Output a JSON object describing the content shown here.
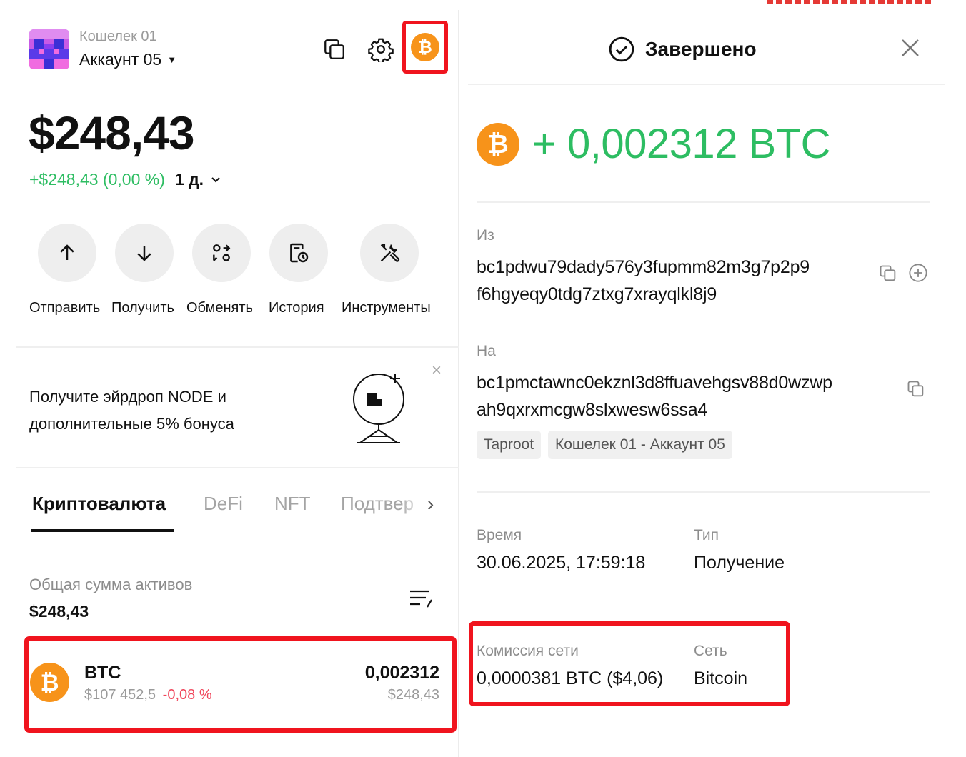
{
  "colors": {
    "accent_red": "#f0141e",
    "positive": "#2dbd62",
    "negative": "#f0455a",
    "btc_orange": "#f7931a"
  },
  "header": {
    "wallet_name": "Кошелек 01",
    "account_name": "Аккаунт 05",
    "icons": [
      "copy-icon",
      "gear-icon",
      "bitcoin-icon"
    ]
  },
  "balance": {
    "total": "$248,43",
    "change": "+$248,43 (0,00 %)",
    "period": "1 д."
  },
  "actions": [
    {
      "label": "Отправить",
      "icon": "arrow-up-icon"
    },
    {
      "label": "Получить",
      "icon": "arrow-down-icon"
    },
    {
      "label": "Обменять",
      "icon": "swap-icon"
    },
    {
      "label": "История",
      "icon": "history-icon"
    },
    {
      "label": "Инструменты",
      "icon": "tools-icon"
    }
  ],
  "promo": {
    "text": "Получите эйрдроп NODE и дополнительные 5% бонуса",
    "close": "×"
  },
  "tabs": [
    "Криптовалюта",
    "DeFi",
    "NFT",
    "Подтвер"
  ],
  "assets_summary": {
    "label": "Общая сумма активов",
    "value": "$248,43"
  },
  "assets": [
    {
      "name": "BTC",
      "price": "$107 452,5",
      "change": "-0,08 %",
      "amount": "0,002312",
      "fiat": "$248,43"
    }
  ],
  "detail": {
    "status": "Завершено",
    "amount": "+ 0,002312 BTC",
    "from_label": "Из",
    "from_line1": "bc1pdwu79dady576y3fupmm82m3g7p2p9",
    "from_line2": "f6hgyeqy0tdg7ztxg7xrayqlkl8j9",
    "to_label": "На",
    "to_line1": "bc1pmctawnc0ekznl3d8ffuavehgsv88d0wzwp",
    "to_line2": "ah9qxrxmcgw8slxwesw6ssa4",
    "to_tags": [
      "Taproot",
      "Кошелек 01 - Аккаунт 05"
    ],
    "time_label": "Время",
    "time_value": "30.06.2025, 17:59:18",
    "type_label": "Тип",
    "type_value": "Получение",
    "fee_label": "Комиссия сети",
    "fee_value": "0,0000381 BTC ($4,06)",
    "network_label": "Сеть",
    "network_value": "Bitcoin"
  }
}
